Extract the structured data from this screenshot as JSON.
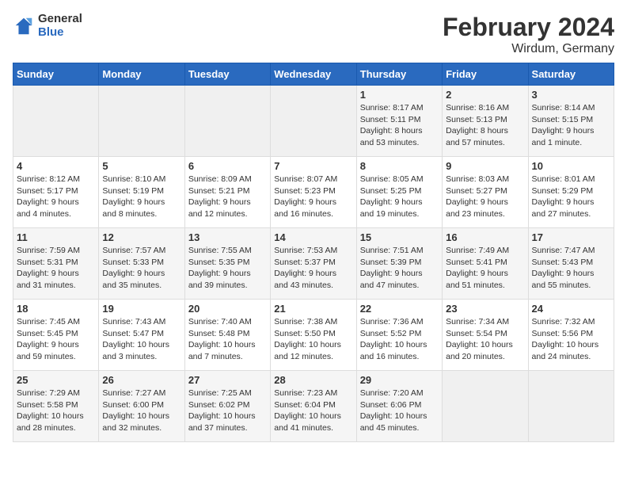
{
  "header": {
    "logo_line1": "General",
    "logo_line2": "Blue",
    "title": "February 2024",
    "subtitle": "Wirdum, Germany"
  },
  "days_of_week": [
    "Sunday",
    "Monday",
    "Tuesday",
    "Wednesday",
    "Thursday",
    "Friday",
    "Saturday"
  ],
  "weeks": [
    [
      {
        "day": "",
        "info": ""
      },
      {
        "day": "",
        "info": ""
      },
      {
        "day": "",
        "info": ""
      },
      {
        "day": "",
        "info": ""
      },
      {
        "day": "1",
        "info": "Sunrise: 8:17 AM\nSunset: 5:11 PM\nDaylight: 8 hours\nand 53 minutes."
      },
      {
        "day": "2",
        "info": "Sunrise: 8:16 AM\nSunset: 5:13 PM\nDaylight: 8 hours\nand 57 minutes."
      },
      {
        "day": "3",
        "info": "Sunrise: 8:14 AM\nSunset: 5:15 PM\nDaylight: 9 hours\nand 1 minute."
      }
    ],
    [
      {
        "day": "4",
        "info": "Sunrise: 8:12 AM\nSunset: 5:17 PM\nDaylight: 9 hours\nand 4 minutes."
      },
      {
        "day": "5",
        "info": "Sunrise: 8:10 AM\nSunset: 5:19 PM\nDaylight: 9 hours\nand 8 minutes."
      },
      {
        "day": "6",
        "info": "Sunrise: 8:09 AM\nSunset: 5:21 PM\nDaylight: 9 hours\nand 12 minutes."
      },
      {
        "day": "7",
        "info": "Sunrise: 8:07 AM\nSunset: 5:23 PM\nDaylight: 9 hours\nand 16 minutes."
      },
      {
        "day": "8",
        "info": "Sunrise: 8:05 AM\nSunset: 5:25 PM\nDaylight: 9 hours\nand 19 minutes."
      },
      {
        "day": "9",
        "info": "Sunrise: 8:03 AM\nSunset: 5:27 PM\nDaylight: 9 hours\nand 23 minutes."
      },
      {
        "day": "10",
        "info": "Sunrise: 8:01 AM\nSunset: 5:29 PM\nDaylight: 9 hours\nand 27 minutes."
      }
    ],
    [
      {
        "day": "11",
        "info": "Sunrise: 7:59 AM\nSunset: 5:31 PM\nDaylight: 9 hours\nand 31 minutes."
      },
      {
        "day": "12",
        "info": "Sunrise: 7:57 AM\nSunset: 5:33 PM\nDaylight: 9 hours\nand 35 minutes."
      },
      {
        "day": "13",
        "info": "Sunrise: 7:55 AM\nSunset: 5:35 PM\nDaylight: 9 hours\nand 39 minutes."
      },
      {
        "day": "14",
        "info": "Sunrise: 7:53 AM\nSunset: 5:37 PM\nDaylight: 9 hours\nand 43 minutes."
      },
      {
        "day": "15",
        "info": "Sunrise: 7:51 AM\nSunset: 5:39 PM\nDaylight: 9 hours\nand 47 minutes."
      },
      {
        "day": "16",
        "info": "Sunrise: 7:49 AM\nSunset: 5:41 PM\nDaylight: 9 hours\nand 51 minutes."
      },
      {
        "day": "17",
        "info": "Sunrise: 7:47 AM\nSunset: 5:43 PM\nDaylight: 9 hours\nand 55 minutes."
      }
    ],
    [
      {
        "day": "18",
        "info": "Sunrise: 7:45 AM\nSunset: 5:45 PM\nDaylight: 9 hours\nand 59 minutes."
      },
      {
        "day": "19",
        "info": "Sunrise: 7:43 AM\nSunset: 5:47 PM\nDaylight: 10 hours\nand 3 minutes."
      },
      {
        "day": "20",
        "info": "Sunrise: 7:40 AM\nSunset: 5:48 PM\nDaylight: 10 hours\nand 7 minutes."
      },
      {
        "day": "21",
        "info": "Sunrise: 7:38 AM\nSunset: 5:50 PM\nDaylight: 10 hours\nand 12 minutes."
      },
      {
        "day": "22",
        "info": "Sunrise: 7:36 AM\nSunset: 5:52 PM\nDaylight: 10 hours\nand 16 minutes."
      },
      {
        "day": "23",
        "info": "Sunrise: 7:34 AM\nSunset: 5:54 PM\nDaylight: 10 hours\nand 20 minutes."
      },
      {
        "day": "24",
        "info": "Sunrise: 7:32 AM\nSunset: 5:56 PM\nDaylight: 10 hours\nand 24 minutes."
      }
    ],
    [
      {
        "day": "25",
        "info": "Sunrise: 7:29 AM\nSunset: 5:58 PM\nDaylight: 10 hours\nand 28 minutes."
      },
      {
        "day": "26",
        "info": "Sunrise: 7:27 AM\nSunset: 6:00 PM\nDaylight: 10 hours\nand 32 minutes."
      },
      {
        "day": "27",
        "info": "Sunrise: 7:25 AM\nSunset: 6:02 PM\nDaylight: 10 hours\nand 37 minutes."
      },
      {
        "day": "28",
        "info": "Sunrise: 7:23 AM\nSunset: 6:04 PM\nDaylight: 10 hours\nand 41 minutes."
      },
      {
        "day": "29",
        "info": "Sunrise: 7:20 AM\nSunset: 6:06 PM\nDaylight: 10 hours\nand 45 minutes."
      },
      {
        "day": "",
        "info": ""
      },
      {
        "day": "",
        "info": ""
      }
    ]
  ]
}
